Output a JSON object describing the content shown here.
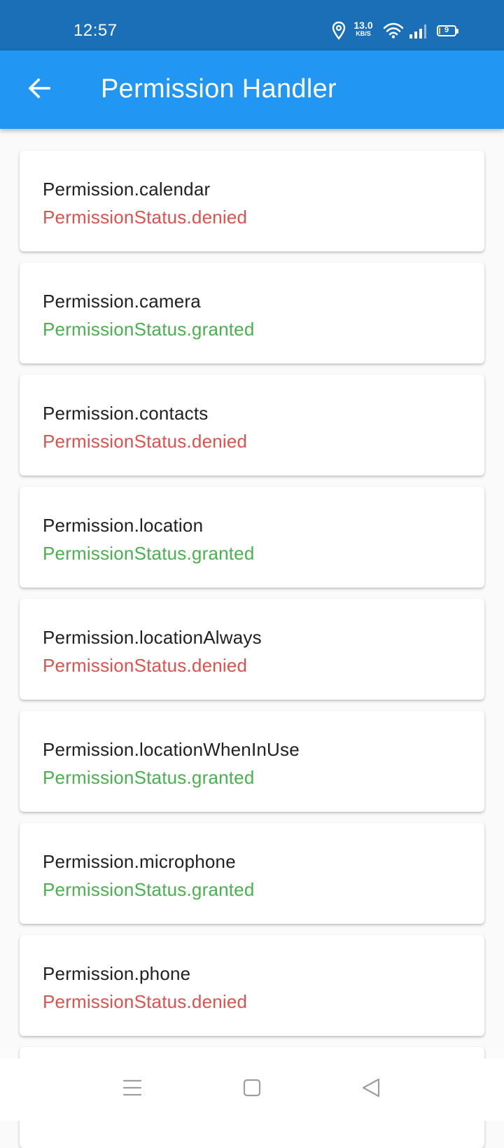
{
  "status_bar": {
    "time": "12:57",
    "net_speed_value": "13.0",
    "net_speed_unit": "KB/S",
    "battery_level": "9",
    "icons": [
      "location-icon",
      "wifi-icon",
      "signal-icon",
      "battery-icon"
    ]
  },
  "app_bar": {
    "title": "Permission Handler",
    "back_icon": "arrow-back-icon",
    "color": "#2196f3"
  },
  "permissions": [
    {
      "name": "Permission.calendar",
      "status": "PermissionStatus.denied",
      "state": "denied"
    },
    {
      "name": "Permission.camera",
      "status": "PermissionStatus.granted",
      "state": "granted"
    },
    {
      "name": "Permission.contacts",
      "status": "PermissionStatus.denied",
      "state": "denied"
    },
    {
      "name": "Permission.location",
      "status": "PermissionStatus.granted",
      "state": "granted"
    },
    {
      "name": "Permission.locationAlways",
      "status": "PermissionStatus.denied",
      "state": "denied"
    },
    {
      "name": "Permission.locationWhenInUse",
      "status": "PermissionStatus.granted",
      "state": "granted"
    },
    {
      "name": "Permission.microphone",
      "status": "PermissionStatus.granted",
      "state": "granted"
    },
    {
      "name": "Permission.phone",
      "status": "PermissionStatus.denied",
      "state": "denied"
    },
    {
      "name": "",
      "status": "",
      "state": ""
    }
  ],
  "colors": {
    "denied": "#d9534f",
    "granted": "#4caf50",
    "title_text": "#212121",
    "status_bar": "#1a6fb7"
  },
  "nav_bar": {
    "icons": [
      "menu-icon",
      "home-square-icon",
      "back-triangle-icon"
    ]
  }
}
